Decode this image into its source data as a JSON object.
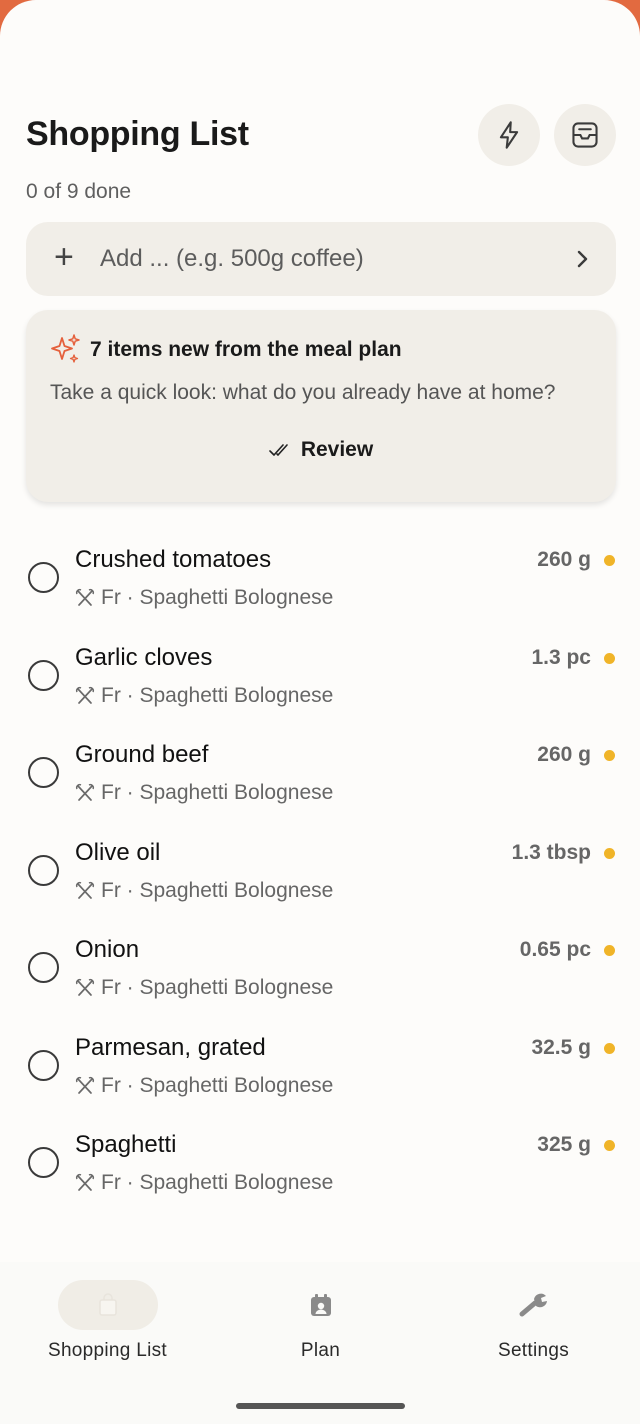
{
  "header": {
    "title": "Shopping List",
    "progress": "0 of 9 done",
    "quick_action_icon": "lightning-icon",
    "archive_icon": "inbox-icon"
  },
  "add_bar": {
    "placeholder": "Add ... (e.g. 500g coffee)",
    "icon": "plus-icon",
    "submit_icon": "chevron-right-icon"
  },
  "suggestion": {
    "icon": "sparkle-icon",
    "title": "7 items new from the meal plan",
    "description": "Take a quick look: what do you already have at home?",
    "action_label": "Review",
    "accent": "#e5603c"
  },
  "items": [
    {
      "name": "Crushed tomatoes",
      "quantity": "260 g",
      "source": "Fr · Spaghetti Bolognese"
    },
    {
      "name": "Garlic cloves",
      "quantity": "1.3 pc",
      "source": "Fr · Spaghetti Bolognese"
    },
    {
      "name": "Ground beef",
      "quantity": "260 g",
      "source": "Fr · Spaghetti Bolognese"
    },
    {
      "name": "Olive oil",
      "quantity": "1.3 tbsp",
      "source": "Fr · Spaghetti Bolognese"
    },
    {
      "name": "Onion",
      "quantity": "0.65 pc",
      "source": "Fr · Spaghetti Bolognese"
    },
    {
      "name": "Parmesan, grated",
      "quantity": "32.5 g",
      "source": "Fr · Spaghetti Bolognese"
    },
    {
      "name": "Spaghetti",
      "quantity": "325 g",
      "source": "Fr · Spaghetti Bolognese"
    }
  ],
  "status_dot_color": "#f0b428",
  "nav": {
    "items": [
      {
        "label": "Shopping List",
        "icon": "shopping-bag-icon",
        "active": true
      },
      {
        "label": "Plan",
        "icon": "calendar-icon",
        "active": false
      },
      {
        "label": "Settings",
        "icon": "wrench-icon",
        "active": false
      }
    ]
  }
}
